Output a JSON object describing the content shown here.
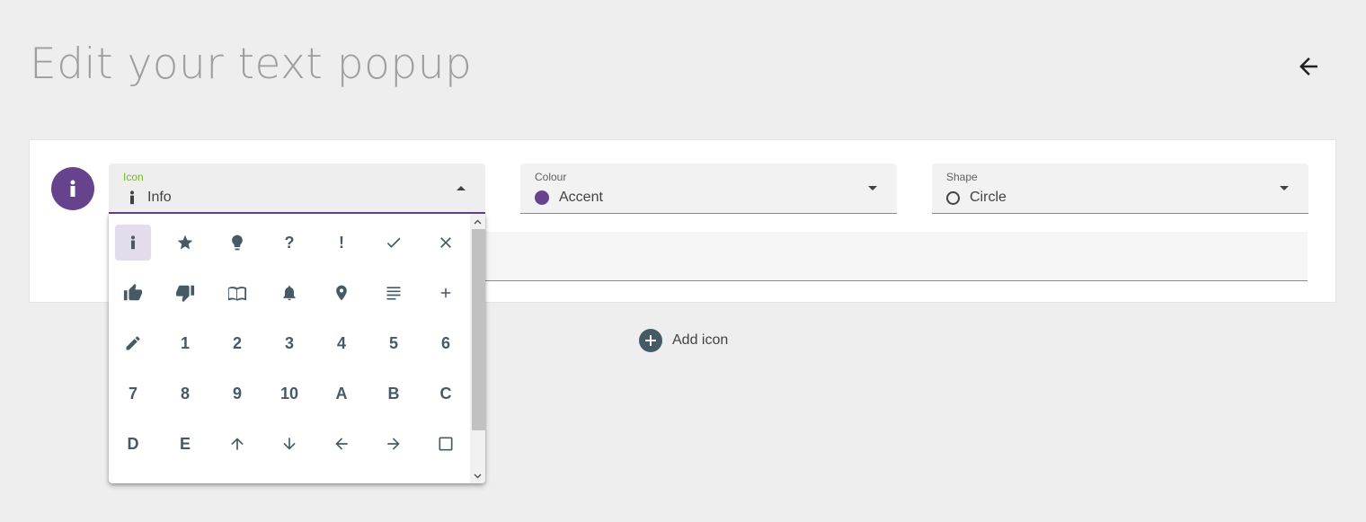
{
  "page": {
    "title": "Edit your text popup"
  },
  "icon_field": {
    "label": "Icon",
    "value": "Info"
  },
  "colour_field": {
    "label": "Colour",
    "value": "Accent",
    "swatch": "#67438d"
  },
  "shape_field": {
    "label": "Shape",
    "value": "Circle"
  },
  "add_icon": {
    "label": "Add icon"
  },
  "colors": {
    "accent": "#67438d",
    "focus_label": "#76b82a",
    "icon_grey": "#455a64"
  },
  "icon_options": [
    {
      "name": "info",
      "text": ""
    },
    {
      "name": "star",
      "text": ""
    },
    {
      "name": "lightbulb",
      "text": ""
    },
    {
      "name": "question",
      "text": "?"
    },
    {
      "name": "exclamation",
      "text": "!"
    },
    {
      "name": "check",
      "text": ""
    },
    {
      "name": "close",
      "text": ""
    },
    {
      "name": "thumb-up",
      "text": ""
    },
    {
      "name": "thumb-down",
      "text": ""
    },
    {
      "name": "book",
      "text": ""
    },
    {
      "name": "bell",
      "text": ""
    },
    {
      "name": "location-pin",
      "text": ""
    },
    {
      "name": "text-lines",
      "text": ""
    },
    {
      "name": "plus",
      "text": ""
    },
    {
      "name": "pencil",
      "text": ""
    },
    {
      "name": "number-1",
      "text": "1"
    },
    {
      "name": "number-2",
      "text": "2"
    },
    {
      "name": "number-3",
      "text": "3"
    },
    {
      "name": "number-4",
      "text": "4"
    },
    {
      "name": "number-5",
      "text": "5"
    },
    {
      "name": "number-6",
      "text": "6"
    },
    {
      "name": "number-7",
      "text": "7"
    },
    {
      "name": "number-8",
      "text": "8"
    },
    {
      "name": "number-9",
      "text": "9"
    },
    {
      "name": "number-10",
      "text": "10"
    },
    {
      "name": "letter-a",
      "text": "A"
    },
    {
      "name": "letter-b",
      "text": "B"
    },
    {
      "name": "letter-c",
      "text": "C"
    },
    {
      "name": "letter-d",
      "text": "D"
    },
    {
      "name": "letter-e",
      "text": "E"
    },
    {
      "name": "arrow-up",
      "text": ""
    },
    {
      "name": "arrow-down",
      "text": ""
    },
    {
      "name": "arrow-left",
      "text": ""
    },
    {
      "name": "arrow-right",
      "text": ""
    },
    {
      "name": "square",
      "text": ""
    }
  ]
}
